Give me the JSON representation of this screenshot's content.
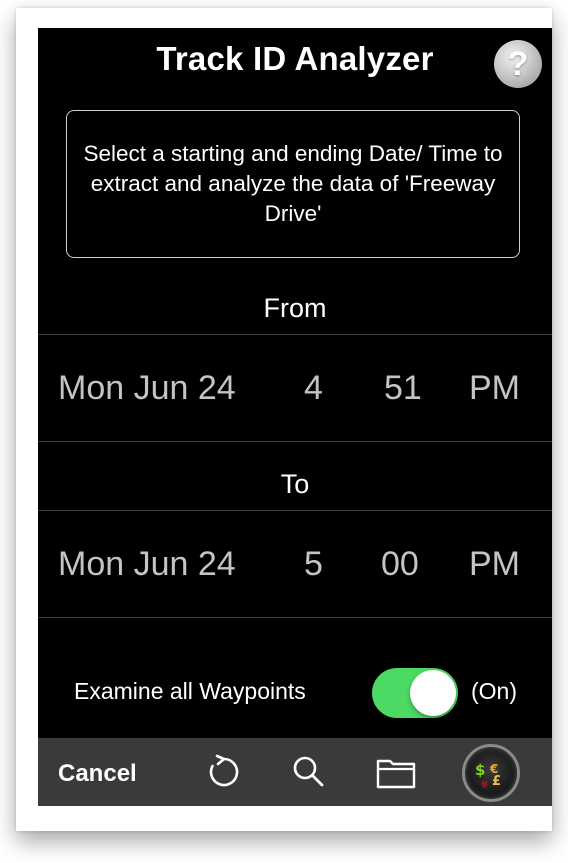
{
  "header": {
    "title": "Track ID Analyzer",
    "help_symbol": "?"
  },
  "message": "Select a starting and ending Date/ Time to extract and analyze the data of 'Freeway Drive'",
  "from": {
    "label": "From",
    "date": "Mon Jun 24",
    "hour": "4",
    "minute": "51",
    "ampm": "PM"
  },
  "to": {
    "label": "To",
    "date": "Mon Jun 24",
    "hour": "5",
    "minute": "00",
    "ampm": "PM"
  },
  "waypoints": {
    "label": "Examine all Waypoints",
    "state": "(On)",
    "enabled": true,
    "color": "#4cd964"
  },
  "toolbar": {
    "cancel_label": "Cancel",
    "icons": [
      "refresh-icon",
      "search-icon",
      "folder-icon",
      "currency-icon"
    ]
  }
}
